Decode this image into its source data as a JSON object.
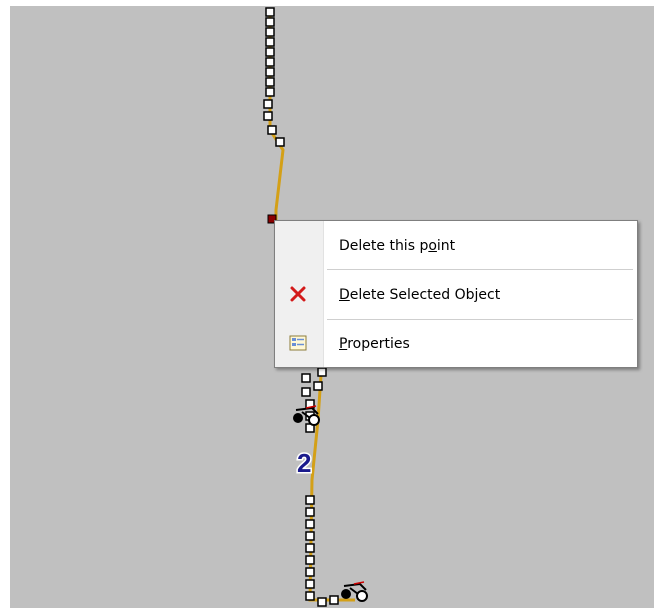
{
  "map": {
    "background_color": "#c0c0c0",
    "route_color": "#d4a017",
    "route_label": "2",
    "route_label_color": "#1a1a8c",
    "icons": [
      "waypoint-marker-icon",
      "bicycle-icon"
    ]
  },
  "context_menu": {
    "items": [
      {
        "label": "Delete this point",
        "mnemonic": "o",
        "icon": ""
      },
      {
        "label": "Delete Selected Object",
        "mnemonic": "D",
        "icon": "delete-x-icon"
      },
      {
        "label": "Properties",
        "mnemonic": "P",
        "icon": "properties-icon"
      }
    ]
  }
}
